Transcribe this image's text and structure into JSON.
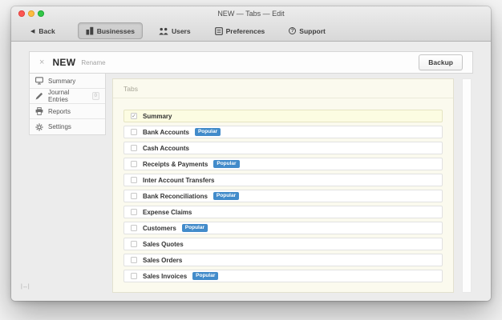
{
  "window": {
    "title": "NEW — Tabs — Edit"
  },
  "toolbar": {
    "back_label": "Back",
    "back_chevron": "◀",
    "items": [
      {
        "label": "Businesses",
        "icon": "buildings-icon",
        "active": true
      },
      {
        "label": "Users",
        "icon": "users-icon",
        "active": false
      },
      {
        "label": "Preferences",
        "icon": "preferences-icon",
        "active": false
      },
      {
        "label": "Support",
        "icon": "support-icon",
        "active": false
      }
    ],
    "support_glyph": "?"
  },
  "header": {
    "close_glyph": "×",
    "business_name": "NEW",
    "rename_label": "Rename",
    "backup_label": "Backup"
  },
  "sidebar": {
    "items": [
      {
        "label": "Summary",
        "icon": "monitor-icon"
      },
      {
        "label": "Journal Entries",
        "icon": "pencil-icon",
        "badge": "0"
      },
      {
        "label": "Reports",
        "icon": "printer-icon"
      },
      {
        "label": "Settings",
        "icon": "gear-icon"
      }
    ]
  },
  "panel": {
    "title": "Tabs",
    "check_glyph": "✓",
    "popular_badge_label": "Popular",
    "popular_badge_color": "#428bca",
    "highlight_color": "#fcfce2",
    "rows": [
      {
        "label": "Summary",
        "checked": true,
        "popular": false
      },
      {
        "label": "Bank Accounts",
        "checked": false,
        "popular": true
      },
      {
        "label": "Cash Accounts",
        "checked": false,
        "popular": false
      },
      {
        "label": "Receipts & Payments",
        "checked": false,
        "popular": true
      },
      {
        "label": "Inter Account Transfers",
        "checked": false,
        "popular": false
      },
      {
        "label": "Bank Reconciliations",
        "checked": false,
        "popular": true
      },
      {
        "label": "Expense Claims",
        "checked": false,
        "popular": false
      },
      {
        "label": "Customers",
        "checked": false,
        "popular": true
      },
      {
        "label": "Sales Quotes",
        "checked": false,
        "popular": false
      },
      {
        "label": "Sales Orders",
        "checked": false,
        "popular": false
      },
      {
        "label": "Sales Invoices",
        "checked": false,
        "popular": true
      }
    ]
  },
  "statusbar": {
    "resize_hint": "|↔|"
  }
}
